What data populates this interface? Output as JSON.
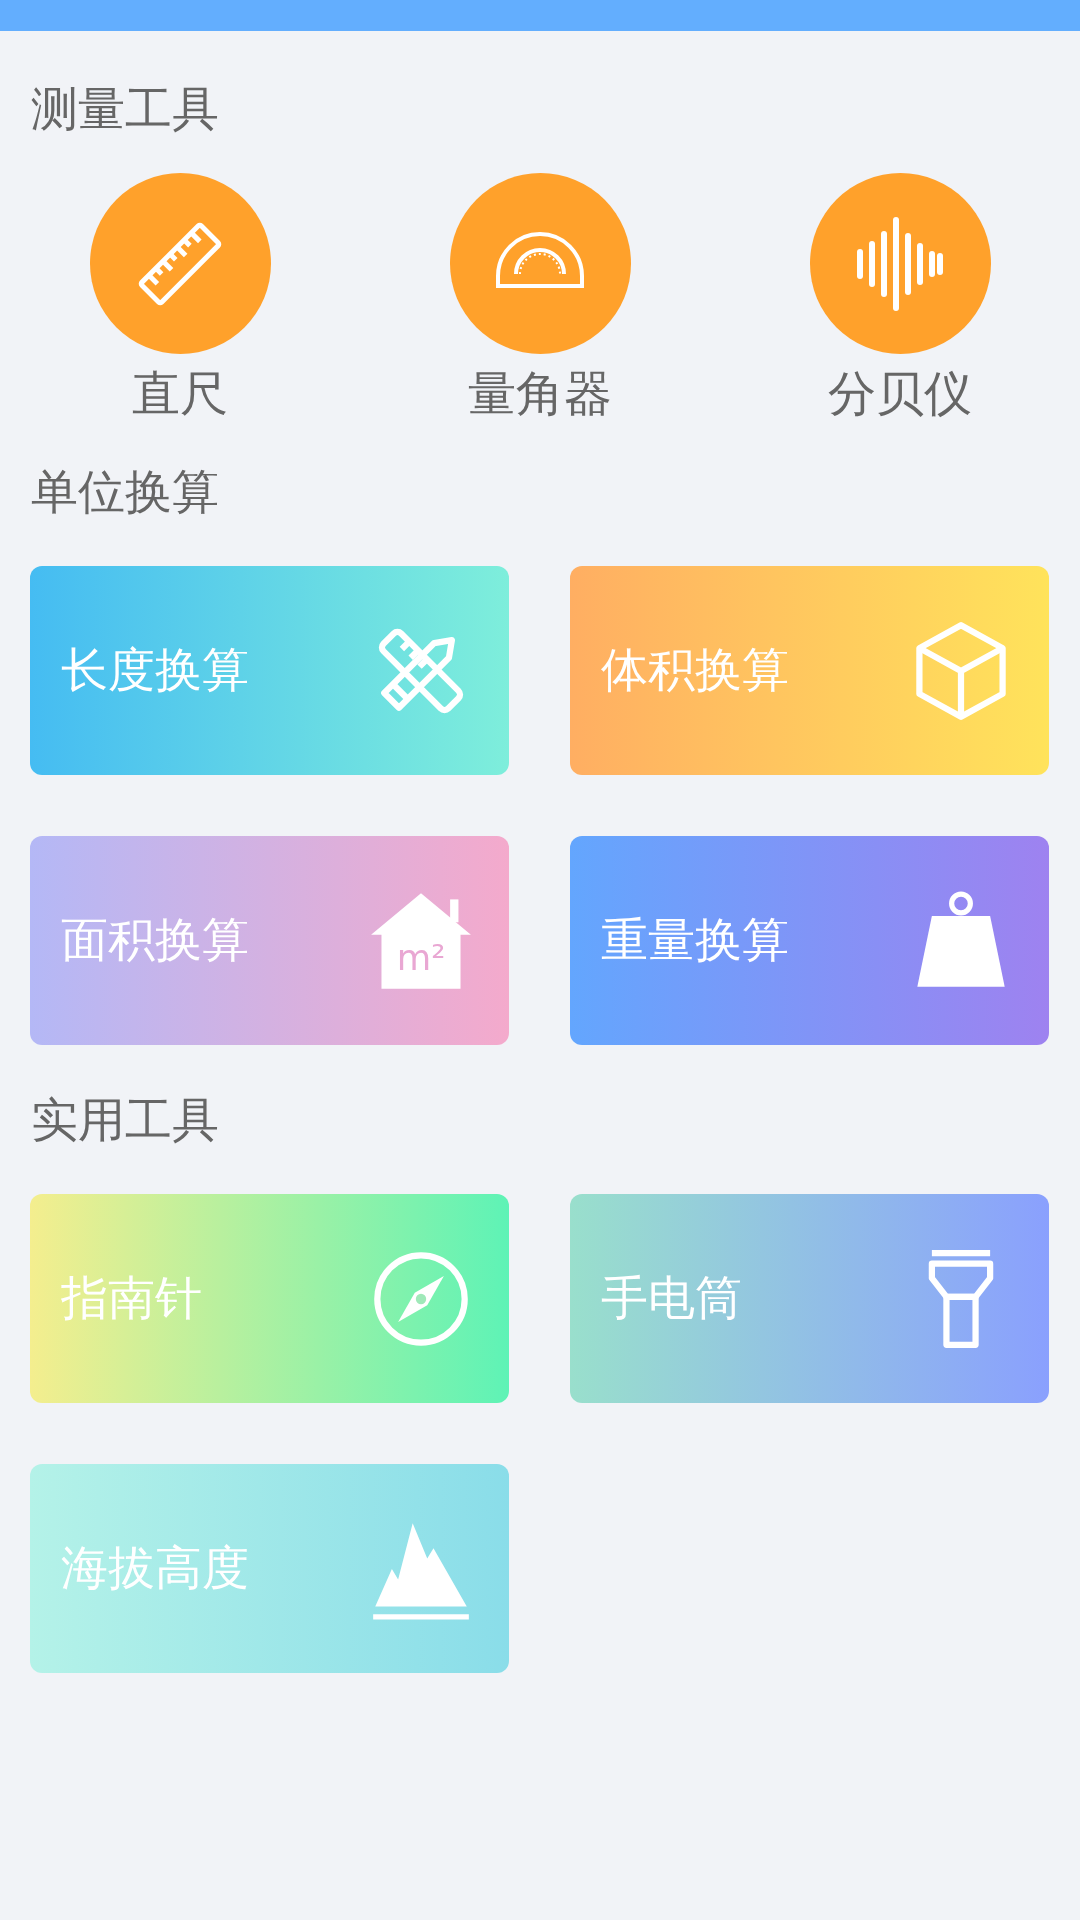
{
  "sections": [
    {
      "title": "测量工具",
      "kind": "circles",
      "items": [
        {
          "label": "直尺"
        },
        {
          "label": "量角器"
        },
        {
          "label": "分贝仪"
        }
      ]
    },
    {
      "title": "单位换算",
      "kind": "cards",
      "items": [
        {
          "label": "长度换算"
        },
        {
          "label": "体积换算"
        },
        {
          "label": "面积换算",
          "icon_text": "m²"
        },
        {
          "label": "重量换算"
        }
      ]
    },
    {
      "title": "实用工具",
      "kind": "cards",
      "items": [
        {
          "label": "指南针"
        },
        {
          "label": "手电筒"
        },
        {
          "label": "海拔高度"
        }
      ]
    }
  ]
}
